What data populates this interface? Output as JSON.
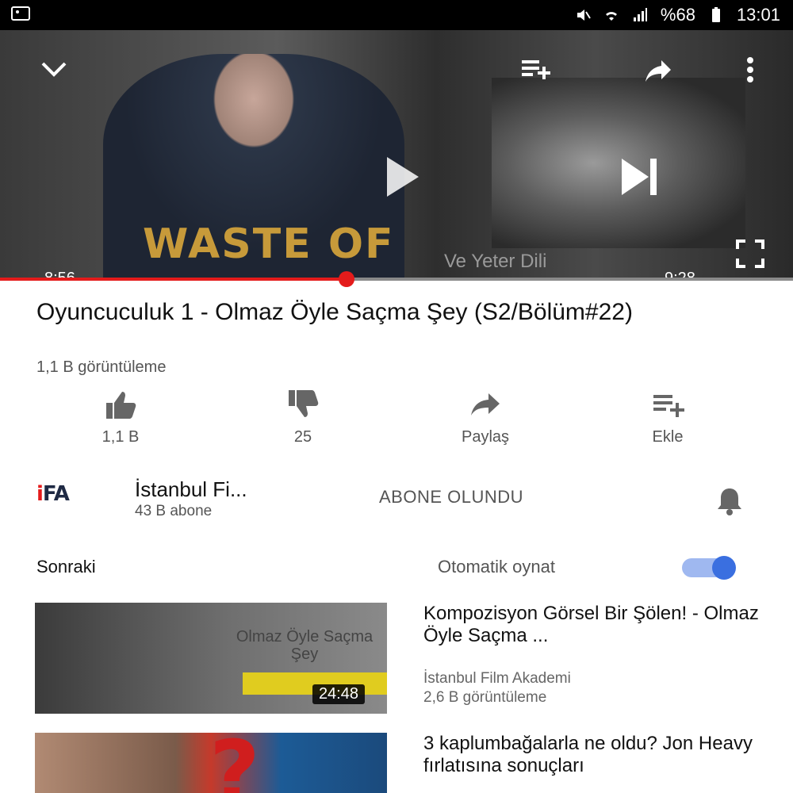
{
  "status_bar": {
    "battery_text": "%68",
    "time": "13:01",
    "icons": [
      "photo-icon",
      "mute-icon",
      "wifi-icon",
      "signal-icon",
      "battery-icon"
    ]
  },
  "player": {
    "elapsed": "8:56",
    "duration": "9:28",
    "progress_fraction": 0.437,
    "shirt_text": "WASTE OF",
    "watermark": "Ve Yeter Dili"
  },
  "video": {
    "title": "Oyuncuculuk 1 - Olmaz Öyle Saçma Şey (S2/Bölüm#22)",
    "views": "1,1 B görüntüleme"
  },
  "actions": [
    {
      "icon": "thumbs-up-icon",
      "label": "1,1 B"
    },
    {
      "icon": "thumbs-down-icon",
      "label": "25"
    },
    {
      "icon": "share-icon",
      "label": "Paylaş"
    },
    {
      "icon": "add-to-playlist-icon",
      "label": "Ekle"
    }
  ],
  "channel": {
    "logo_prefix": "i",
    "logo_main": "FA",
    "name": "İstanbul Fi...",
    "subscribers": "43 B abone",
    "subscribe_label": "ABONE OLUNDU"
  },
  "up_next": {
    "label": "Sonraki",
    "autoplay_label": "Otomatik oynat",
    "autoplay_on": true
  },
  "suggestions": [
    {
      "title": "Kompozisyon Görsel Bir Şölen! - Olmaz Öyle Saçma ...",
      "channel": "İstanbul Film Akademi",
      "views": "2,6 B görüntüleme",
      "duration": "24:48",
      "thumb_overlay": "Olmaz Öyle Saçma Şey"
    },
    {
      "title": "3 kaplumbağalarla ne oldu? Jon Heavy fırlatısına sonuçları",
      "channel": "",
      "views": "",
      "duration": "",
      "thumb_overlay": "?"
    }
  ],
  "colors": {
    "accent_red": "#e41b1b",
    "toggle_blue": "#3a6fe0"
  }
}
